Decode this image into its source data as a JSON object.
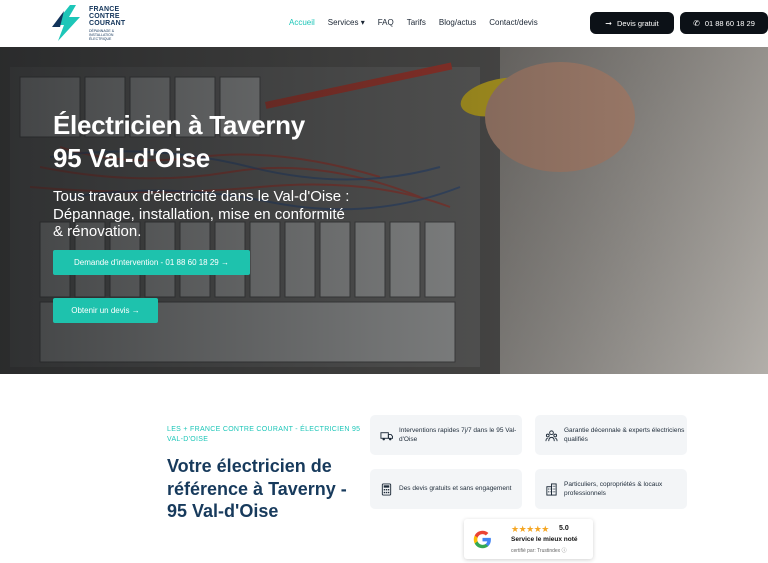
{
  "brand": {
    "line1": "FRANCE",
    "line2": "CONTRE",
    "line3": "COURANT",
    "tagline": "DÉPANNAGE & INSTALLATION ÉLECTRIQUE",
    "colors": {
      "primary": "#1dc6b8",
      "navy": "#12345a",
      "dark": "#0c1117"
    }
  },
  "nav": {
    "items": [
      "Accueil",
      "Services ▾",
      "FAQ",
      "Tarifs",
      "Blog/actus",
      "Contact/devis"
    ],
    "active": "Accueil"
  },
  "header_buttons": {
    "devis": {
      "icon": "arrow-right-icon",
      "label": "Devis gratuit"
    },
    "phone": {
      "icon": "phone-icon",
      "label": "01 88 60 18 29"
    }
  },
  "hero": {
    "title_line1": "Électricien à Taverny",
    "title_line2": "95 Val-d'Oise",
    "subtitle": "Tous travaux d'électricité dans le Val-d'Oise : Dépannage, installation, mise en conformité & rénovation.",
    "cta_intervention": "Demande d'intervention - 01 88 60 18 29 →",
    "cta_devis": "Obtenir un devis →"
  },
  "about": {
    "eyebrow": "LES + FRANCE CONTRE COURANT - ÉLECTRICIEN 95 VAL-D'OISE",
    "title": "Votre électricien de référence à Taverny - 95 Val-d'Oise"
  },
  "features": [
    {
      "icon": "truck-icon",
      "text": "Interventions rapides 7j/7 dans le 95 Val-d'Oise"
    },
    {
      "icon": "team-icon",
      "text": "Garantie décennale & experts électriciens qualifiés"
    },
    {
      "icon": "calculator-icon",
      "text": "Des devis gratuits et sans engagement"
    },
    {
      "icon": "building-icon",
      "text": "Particuliers, copropriétés & locaux professionnels"
    }
  ],
  "review": {
    "stars": "★★★★★",
    "score": "5.0",
    "label": "Service le mieux noté",
    "certified": "certifié par: Trustindex ⓘ"
  }
}
